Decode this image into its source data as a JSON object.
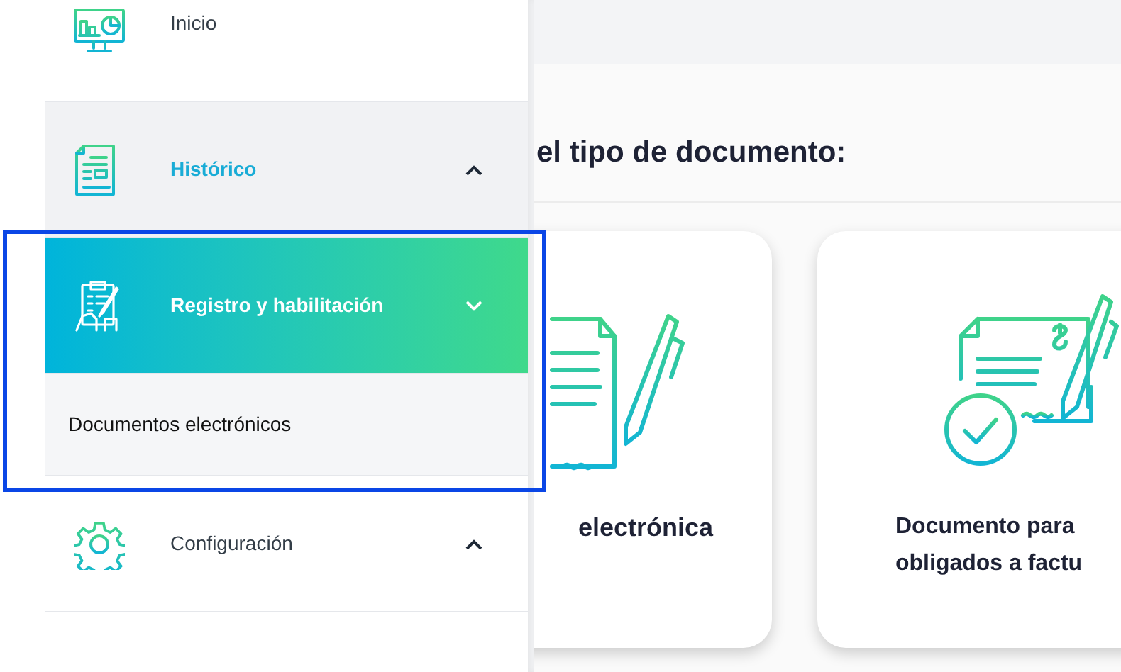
{
  "sidebar": {
    "items": [
      {
        "kind": "dashboard",
        "label": "Inicio",
        "selected": false,
        "hovered": false
      },
      {
        "kind": "history",
        "label": "Histórico",
        "selected": false,
        "hovered": true,
        "expanded": false
      },
      {
        "kind": "registration",
        "label": "Registro y habilitación",
        "selected": true,
        "expanded": true,
        "children": [
          {
            "label": "Documentos electrónicos"
          }
        ]
      },
      {
        "kind": "settings",
        "label": "Configuración",
        "selected": false,
        "hovered": false,
        "expanded": false
      }
    ]
  },
  "main": {
    "heading": "el tipo de documento:",
    "cards": [
      {
        "kind": "signed-document",
        "lines": [
          "electrónica"
        ]
      },
      {
        "kind": "invoice",
        "lines": [
          "Documento para",
          "obligados a factu"
        ]
      }
    ]
  }
}
